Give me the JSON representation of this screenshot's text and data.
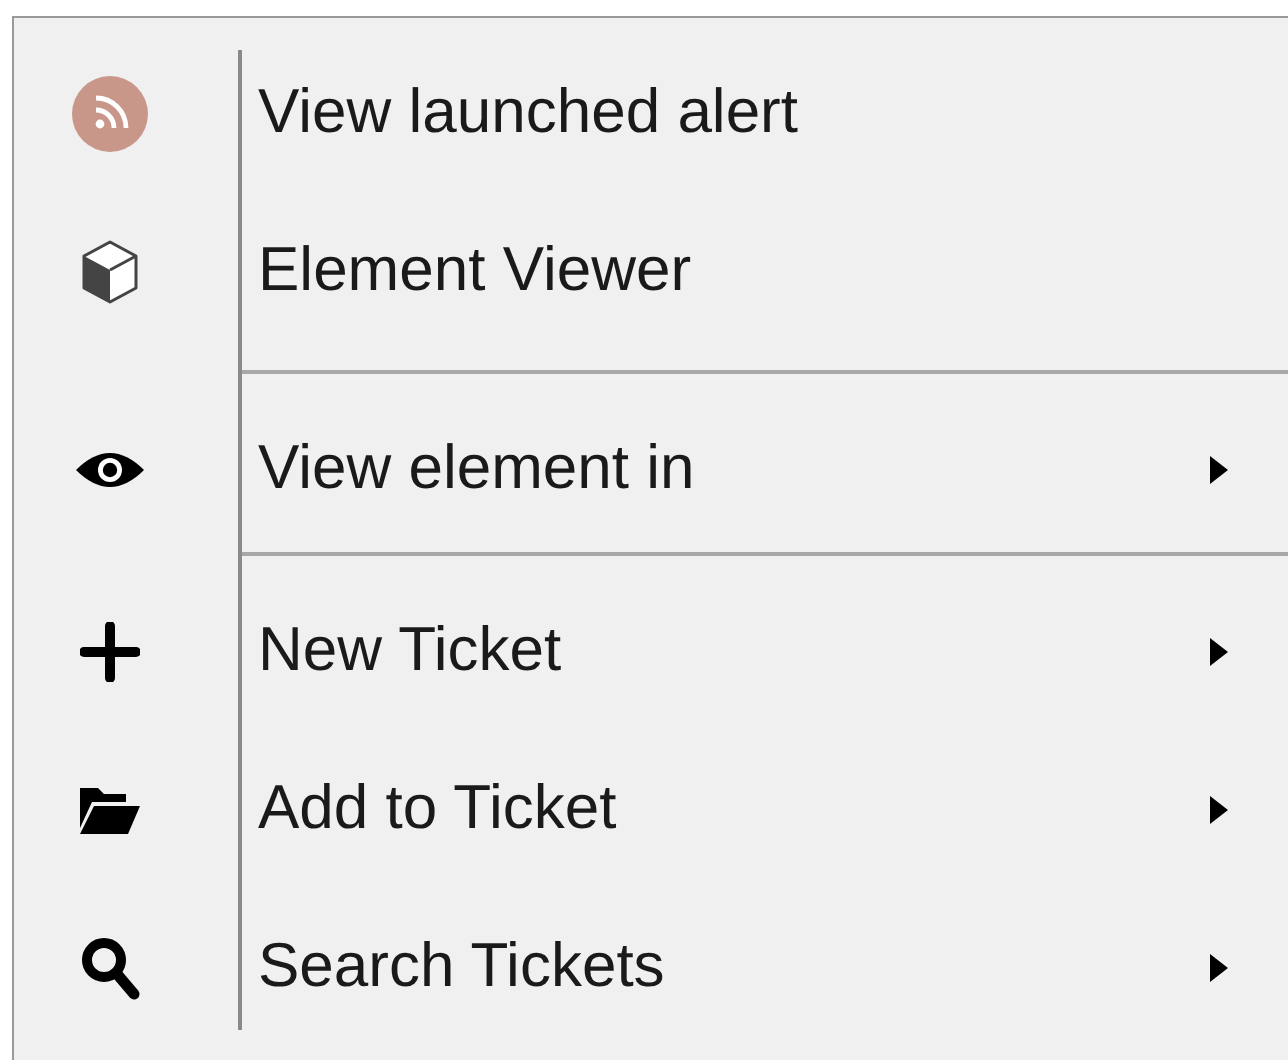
{
  "menu": {
    "groups": [
      {
        "items": [
          {
            "label": "View launched alert",
            "has_submenu": false
          },
          {
            "label": "Element Viewer",
            "has_submenu": false
          }
        ]
      },
      {
        "items": [
          {
            "label": "View element in",
            "has_submenu": true
          }
        ]
      },
      {
        "items": [
          {
            "label": "New Ticket",
            "has_submenu": true
          },
          {
            "label": "Add to Ticket",
            "has_submenu": true
          },
          {
            "label": "Search Tickets",
            "has_submenu": true
          }
        ]
      }
    ]
  }
}
